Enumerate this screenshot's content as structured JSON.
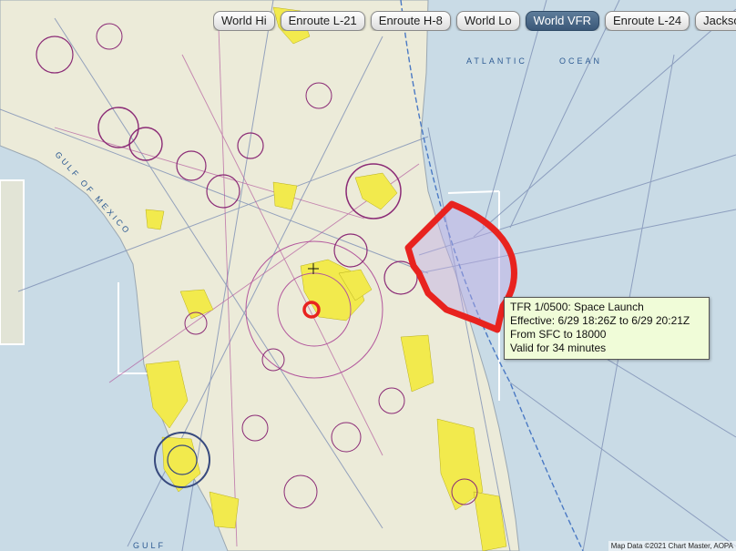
{
  "chart_tabs": [
    {
      "label": "World Hi",
      "active": false
    },
    {
      "label": "Enroute L-21",
      "active": false
    },
    {
      "label": "Enroute H-8",
      "active": false
    },
    {
      "label": "World Lo",
      "active": false
    },
    {
      "label": "World VFR",
      "active": true
    },
    {
      "label": "Enroute L-24",
      "active": false
    },
    {
      "label": "Jackson",
      "active": false
    }
  ],
  "map_labels": {
    "ocean_left": "ATLANTIC",
    "ocean_right": "OCEAN",
    "gulf": "GULF OF MEXICO",
    "gulf_bottom": "GULF"
  },
  "tfr": {
    "title": "TFR 1/0500: Space Launch",
    "effective": "Effective: 6/29 18:26Z to 6/29 20:21Z",
    "altitude": "From SFC to 18000",
    "valid": "Valid for 34 minutes"
  },
  "colors": {
    "tfr_outline": "#e8231f",
    "land": "#ecebd9",
    "water": "#c9dbe6",
    "urban": "#f2ea4d",
    "tab_active": "#4a6988"
  },
  "copyright": "Map Data ©2021 Chart Master, AOPA"
}
